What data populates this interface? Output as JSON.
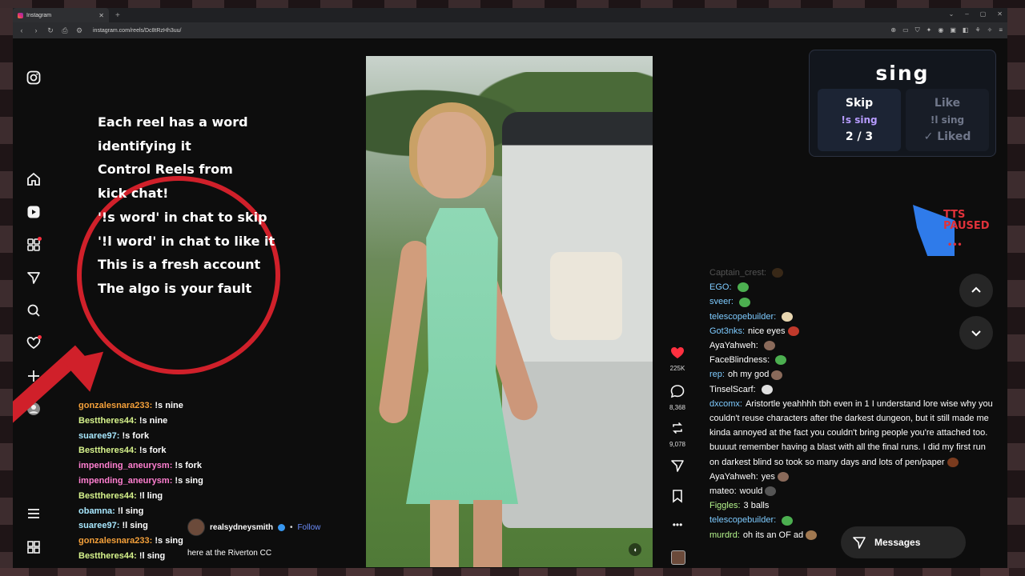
{
  "browser": {
    "tab_title": "Instagram",
    "url": "instagram.com/reels/Dc8tRzHh3uu/",
    "new_tab": "+"
  },
  "overlay": {
    "lines": [
      "Each reel has a word",
      "identifying it",
      "Control Reels from",
      "kick chat!",
      "'!s word' in chat to skip",
      "'!l word' in chat to like it",
      "This is a fresh account",
      "The algo is your fault"
    ]
  },
  "chat_left": [
    {
      "user": "gonzalesnara233:",
      "msg": "!s nine",
      "color": "#f4a03a"
    },
    {
      "user": "Besttheres44:",
      "msg": "!s nine",
      "color": "#d7f38c"
    },
    {
      "user": "suaree97:",
      "msg": "!s fork",
      "color": "#a8e8ff"
    },
    {
      "user": "Besttheres44:",
      "msg": "!s fork",
      "color": "#d7f38c"
    },
    {
      "user": "impending_aneurysm:",
      "msg": "!s fork",
      "color": "#ff7fd0"
    },
    {
      "user": "impending_aneurysm:",
      "msg": "!s sing",
      "color": "#ff7fd0"
    },
    {
      "user": "Besttheres44:",
      "msg": "!l ling",
      "color": "#d7f38c"
    },
    {
      "user": "obamna:",
      "msg": "!l sing",
      "color": "#a8e8ff"
    },
    {
      "user": "suaree97:",
      "msg": "!l sing",
      "color": "#a8e8ff"
    },
    {
      "user": "gonzalesnara233:",
      "msg": "!s sing",
      "color": "#f4a03a"
    },
    {
      "user": "Besttheres44:",
      "msg": "!l sing",
      "color": "#d7f38c"
    }
  ],
  "reel": {
    "author": "realsydneysmith",
    "follow": "Follow",
    "separator": "•",
    "caption": "here at the Riverton CC",
    "likes": "225K",
    "comments": "8,368",
    "reposts": "9,078"
  },
  "sing_panel": {
    "word": "sing",
    "skip_title": "Skip",
    "skip_cmd": "!s sing",
    "skip_count": "2 / 3",
    "like_title": "Like",
    "like_cmd": "!l sing",
    "like_status": "✓ Liked"
  },
  "tts": {
    "line1": "TTS",
    "line2": "PAUSED",
    "dots": "•••"
  },
  "chat_right": [
    {
      "user": "Captain_crest:",
      "msg": "",
      "color": "#d0d0d0",
      "emote": "#8a5a2b"
    },
    {
      "user": "EGO:",
      "msg": "",
      "color": "#7ecbff",
      "emote": "#4caf50"
    },
    {
      "user": "sveer:",
      "msg": "",
      "color": "#7ecbff",
      "emote": "#4caf50"
    },
    {
      "user": "telescopebuilder:",
      "msg": "",
      "color": "#7ecbff",
      "emote": "#e8d6b0"
    },
    {
      "user": "Got3nks:",
      "msg": "nice eyes",
      "color": "#7ecbff",
      "emote": "#c0392b"
    },
    {
      "user": "AyaYahweh:",
      "msg": "",
      "color": "#ffffff",
      "emote": "#8a6a5a"
    },
    {
      "user": "FaceBlindness:",
      "msg": "",
      "color": "#ffffff",
      "emote": "#4caf50"
    },
    {
      "user": "rep:",
      "msg": "oh my god",
      "color": "#7ecbff",
      "emote": "#8a6a5a"
    },
    {
      "user": "TinselScarf:",
      "msg": "",
      "color": "#ffffff",
      "emote": "#e0e0e0"
    },
    {
      "user": "dxcomx:",
      "msg": "Aristortle yeahhhh tbh even in 1 I understand lore wise why you couldn't reuse characters after the darkest dungeon, but it still made me kinda annoyed at the fact you couldn't bring people you're attached too. buuuut remember having a blast with all the final runs. I did my first run on darkest blind so took so many days and lots of pen/paper",
      "color": "#7ecbff",
      "emote": "#7a3b1e"
    },
    {
      "user": "AyaYahweh:",
      "msg": "yes",
      "color": "#ffffff",
      "emote": "#8a6a5a"
    },
    {
      "user": "mateo:",
      "msg": "would",
      "color": "#ffffff",
      "emote": "#555555"
    },
    {
      "user": "Figgles:",
      "msg": "3 balls",
      "color": "#b5f58c",
      "emote": ""
    },
    {
      "user": "telescopebuilder:",
      "msg": "",
      "color": "#7ecbff",
      "emote": "#4caf50"
    },
    {
      "user": "murdrd:",
      "msg": "oh its an OF ad",
      "color": "#b5f58c",
      "emote": "#a07850"
    }
  ],
  "messages_button": "Messages",
  "icons": {
    "instagram": "instagram-logo-icon",
    "home": "home-icon",
    "reels": "reels-icon",
    "explore": "explore-icon",
    "messages": "send-icon",
    "search": "search-icon",
    "notifications": "heart-icon",
    "create": "plus-icon",
    "profile": "profile-icon",
    "menu": "hamburger-icon",
    "more": "grid-icon"
  }
}
